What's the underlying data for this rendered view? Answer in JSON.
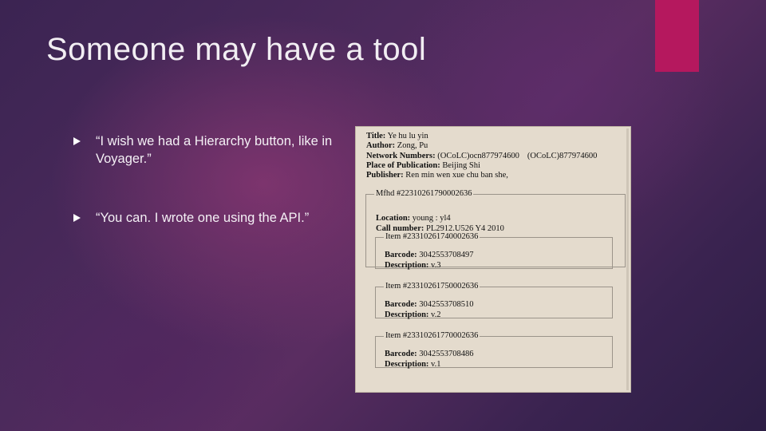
{
  "slide": {
    "title": "Someone may have a tool",
    "bullets": [
      "“I wish we had a Hierarchy button, like in Voyager.”",
      "“You can. I wrote one using the API.”"
    ],
    "accent_color": "#b5185e"
  },
  "record": {
    "title_label": "Title:",
    "title_value": "Ye hu lu yin",
    "author_label": "Author:",
    "author_value": "Zong, Pu",
    "network_label": "Network Numbers:",
    "network_value1": "(OCoLC)ocn877974600",
    "network_value2": "(OCoLC)877974600",
    "place_label": "Place of Publication:",
    "place_value": "Beijing Shi",
    "publisher_label": "Publisher:",
    "publisher_value": "Ren min wen xue chu ban she,",
    "mfhd": {
      "legend": "Mfhd #22310261790002636",
      "location_label": "Location:",
      "location_value": "young : yl4",
      "callnumber_label": "Call number:",
      "callnumber_value": "PL2912.U526 Y4 2010"
    },
    "items": [
      {
        "legend": "Item #23310261740002636",
        "barcode_label": "Barcode:",
        "barcode": "3042553708497",
        "description_label": "Description:",
        "description": "v.3"
      },
      {
        "legend": "Item #23310261750002636",
        "barcode_label": "Barcode:",
        "barcode": "3042553708510",
        "description_label": "Description:",
        "description": "v.2"
      },
      {
        "legend": "Item #23310261770002636",
        "barcode_label": "Barcode:",
        "barcode": "3042553708486",
        "description_label": "Description:",
        "description": "v.1"
      }
    ]
  }
}
